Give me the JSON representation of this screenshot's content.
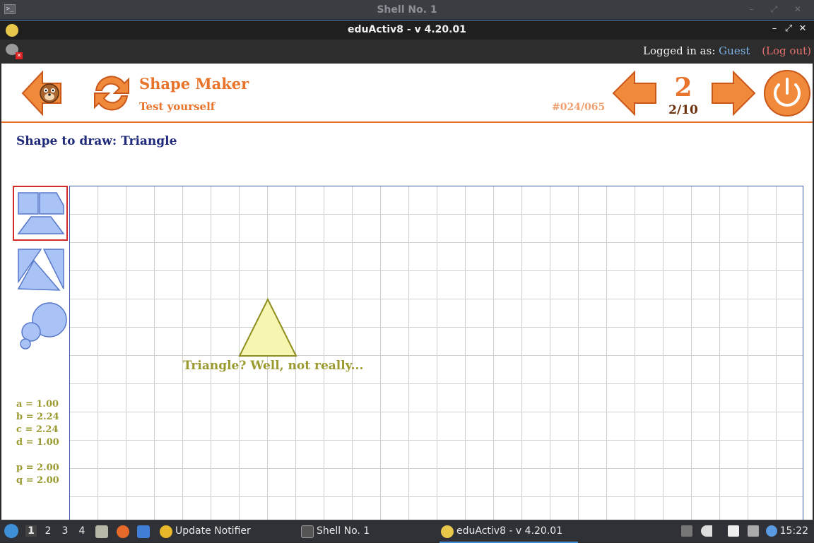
{
  "shell_window": {
    "title": "Shell No. 1"
  },
  "app_window": {
    "title": "eduActiv8 - v 4.20.01"
  },
  "login": {
    "prefix": "Logged in as:",
    "user": "Guest",
    "logout": "(Log out)"
  },
  "header": {
    "app_name": "Shape Maker",
    "app_subtitle": "Test yourself",
    "level_code": "#024/065",
    "level_number": "2",
    "level_progress": "2/10"
  },
  "task": {
    "text": "Shape to draw: Triangle"
  },
  "tools": [
    {
      "name": "quadrilaterals",
      "selected": true
    },
    {
      "name": "triangles",
      "selected": false
    },
    {
      "name": "circles",
      "selected": false
    }
  ],
  "feedback": {
    "text": "Triangle? Well, not really..."
  },
  "measures": {
    "a": "a = 1.00",
    "b": "b = 2.24",
    "c": "c = 2.24",
    "d": "d = 1.00",
    "p": "p = 2.00",
    "q": "q = 2.00"
  },
  "taskbar": {
    "workspaces": [
      "1",
      "2",
      "3",
      "4"
    ],
    "tasks": [
      "Update Notifier",
      "Shell No. 1",
      "eduActiv8 - v 4.20.01"
    ],
    "clock": "15:22"
  },
  "colors": {
    "accent": "#e8732a",
    "shape_fill": "#f5f7b0",
    "shape_stroke": "#8e8e20",
    "tool_fill": "#a9c3f7",
    "tool_stroke": "#5878c8",
    "selection": "#d42a2a"
  }
}
